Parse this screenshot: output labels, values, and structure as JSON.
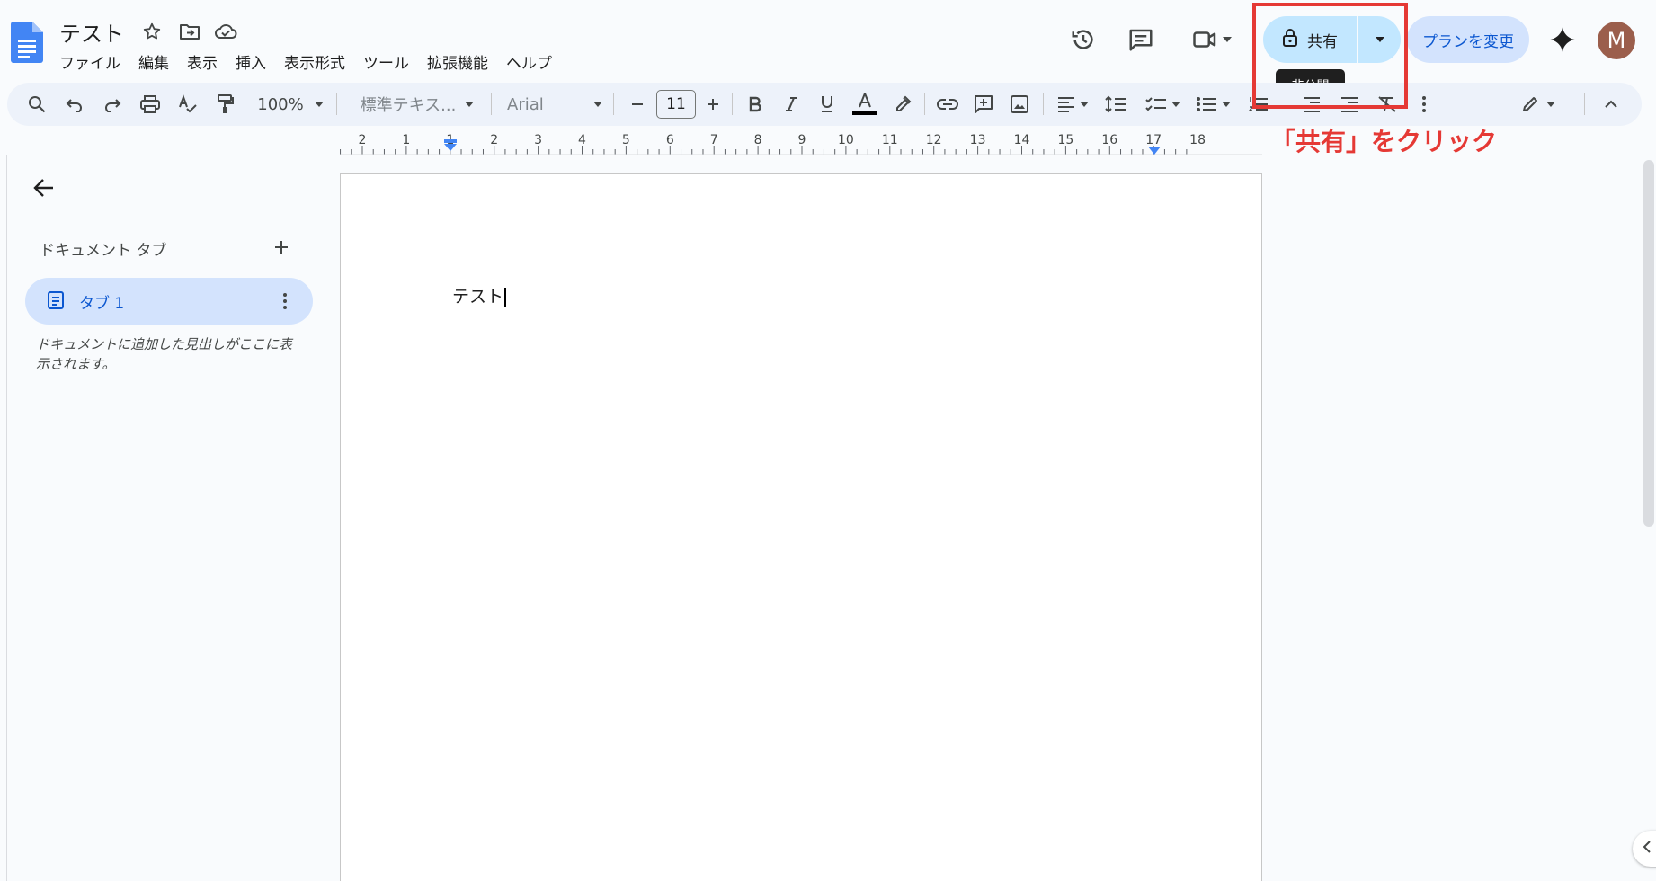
{
  "doc": {
    "title": "テスト"
  },
  "menu": [
    "ファイル",
    "編集",
    "表示",
    "挿入",
    "表示形式",
    "ツール",
    "拡張機能",
    "ヘルプ"
  ],
  "header": {
    "share_label": "共有",
    "share_tooltip": "非公開",
    "plan_label": "プランを変更",
    "avatar_initial": "M"
  },
  "toolbar": {
    "zoom": "100%",
    "style": "標準テキス...",
    "font": "Arial",
    "font_size": "11"
  },
  "ruler": {
    "labels": [
      "2",
      "1",
      "1",
      "2",
      "3",
      "4",
      "5",
      "6",
      "7",
      "8",
      "9",
      "10",
      "11",
      "12",
      "13",
      "14",
      "15",
      "16",
      "17",
      "18"
    ]
  },
  "side_panel": {
    "heading": "ドキュメント タブ",
    "tab_label": "タブ 1",
    "outline_hint": "ドキュメントに追加した見出しがここに表示されます。"
  },
  "page": {
    "body_text": "テスト"
  },
  "annotation": {
    "text": "「共有」をクリック",
    "color": "#e53935"
  },
  "colors": {
    "accent": "#0b57d0",
    "share_bg": "#c2e7ff",
    "plan_bg": "#d3e3fd",
    "toolbar_bg": "#edf2fa",
    "avatar_bg": "#9b5e4c"
  },
  "icons": [
    "docs-logo-icon",
    "star-icon",
    "move-folder-icon",
    "cloud-saved-icon",
    "history-icon",
    "comment-icon",
    "video-call-icon",
    "lock-icon",
    "gemini-icon"
  ]
}
